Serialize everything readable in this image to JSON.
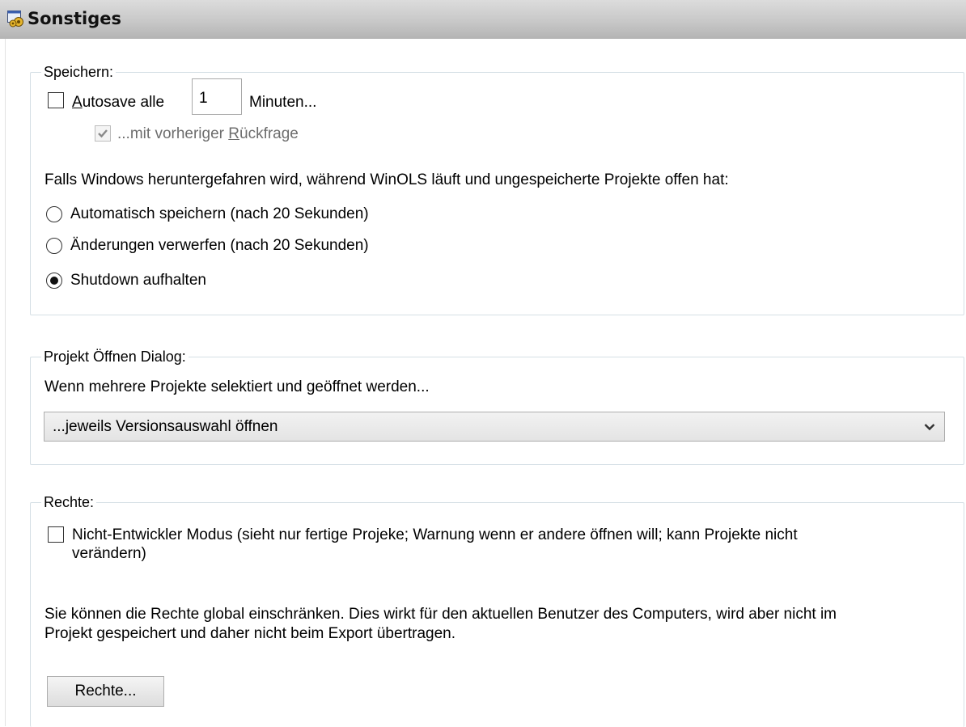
{
  "window": {
    "title": "Sonstiges"
  },
  "speichern": {
    "legend": "Speichern:",
    "autosave": {
      "pre": "A",
      "post": "utosave alle",
      "checked": false,
      "minutes_value": "1",
      "minutes_suffix": "Minuten..."
    },
    "confirm": {
      "pre": "...mit vorheriger ",
      "mnemonic": "R",
      "post": "ückfrage",
      "checked": true,
      "disabled": true
    },
    "shutdown_text": "Falls Windows heruntergefahren wird, während WinOLS läuft und ungespeicherte Projekte offen hat:",
    "options": [
      {
        "label": "Automatisch speichern (nach 20 Sekunden)",
        "selected": false
      },
      {
        "label": "Änderungen verwerfen (nach 20 Sekunden)",
        "selected": false
      },
      {
        "label": "Shutdown aufhalten",
        "selected": true
      }
    ]
  },
  "projekt": {
    "legend": "Projekt Öffnen Dialog:",
    "description": "Wenn mehrere Projekte selektiert und geöffnet werden...",
    "dropdown_value": "...jeweils Versionsauswahl öffnen"
  },
  "rechte": {
    "legend": "Rechte:",
    "checkbox_line1": "Nicht-Entwickler Modus (sieht nur fertige Projeke; Warnung wenn er andere öffnen will; kann Projekte nicht",
    "checkbox_line2": "verändern)",
    "checkbox_checked": false,
    "info_line1": "Sie können die Rechte global einschränken. Dies wirkt für den aktuellen Benutzer des Computers, wird aber nicht im",
    "info_line2": "Projekt gespeichert und daher nicht beim Export übertragen.",
    "button_label": "Rechte..."
  }
}
